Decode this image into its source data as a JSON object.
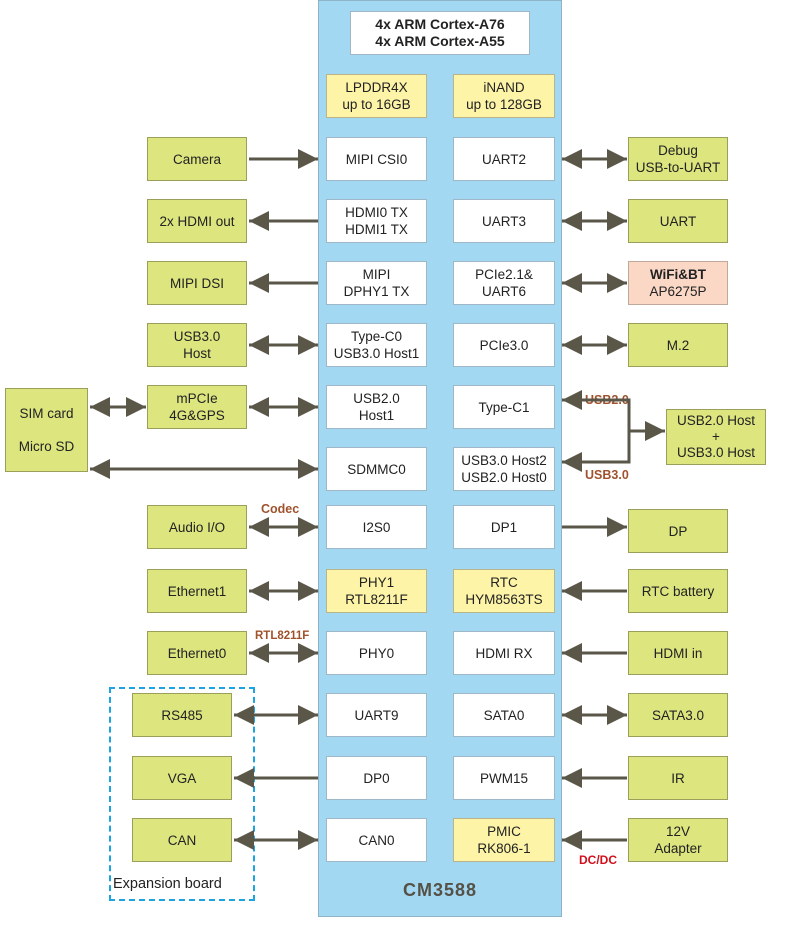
{
  "chip": {
    "name": "CM3588",
    "cpu": [
      "4x ARM Cortex-A76",
      "4x ARM Cortex-A55"
    ],
    "memory": [
      "LPDDR4X",
      "up to 16GB"
    ],
    "storage": [
      "iNAND",
      "up to 128GB"
    ]
  },
  "colors": {
    "panel": "#a3d8f3",
    "external": "#dde57f",
    "onboard": "#fdf4a8",
    "wireless": "#fbd8c5",
    "arrow": "#5a5648",
    "annotation": "#a0522d",
    "power_annotation": "#d0101c",
    "expansion_border": "#1ca3e0"
  },
  "interfaces_left": [
    {
      "lines": [
        "MIPI CSI0"
      ]
    },
    {
      "lines": [
        "HDMI0 TX",
        "HDMI1 TX"
      ]
    },
    {
      "lines": [
        "MIPI",
        "DPHY1 TX"
      ]
    },
    {
      "lines": [
        "Type-C0",
        "USB3.0 Host1"
      ]
    },
    {
      "lines": [
        "USB2.0",
        "Host1"
      ]
    },
    {
      "lines": [
        "SDMMC0"
      ]
    },
    {
      "lines": [
        "I2S0"
      ]
    },
    {
      "lines": [
        "PHY1",
        "RTL8211F"
      ]
    },
    {
      "lines": [
        "PHY0"
      ]
    },
    {
      "lines": [
        "UART9"
      ]
    },
    {
      "lines": [
        "DP0"
      ]
    },
    {
      "lines": [
        "CAN0"
      ]
    }
  ],
  "interfaces_right": [
    {
      "lines": [
        "UART2"
      ]
    },
    {
      "lines": [
        "UART3"
      ]
    },
    {
      "lines": [
        "PCIe2.1&",
        "UART6"
      ]
    },
    {
      "lines": [
        "PCIe3.0"
      ]
    },
    {
      "lines": [
        "Type-C1"
      ]
    },
    {
      "lines": [
        "USB3.0 Host2",
        "USB2.0 Host0"
      ]
    },
    {
      "lines": [
        "DP1"
      ]
    },
    {
      "lines": [
        "RTC",
        "HYM8563TS"
      ]
    },
    {
      "lines": [
        "HDMI RX"
      ]
    },
    {
      "lines": [
        "SATA0"
      ]
    },
    {
      "lines": [
        "PWM15"
      ]
    },
    {
      "lines": [
        "PMIC",
        "RK806-1"
      ]
    }
  ],
  "peripherals_left": [
    {
      "lines": [
        "Camera"
      ],
      "direction": "in"
    },
    {
      "lines": [
        "2x HDMI out"
      ],
      "direction": "out"
    },
    {
      "lines": [
        "MIPI DSI"
      ],
      "direction": "out"
    },
    {
      "lines": [
        "USB3.0",
        "Host"
      ],
      "direction": "both"
    },
    {
      "lines": [
        "mPCIe",
        "4G&GPS"
      ],
      "direction": "both"
    },
    {
      "lines": [
        "Audio I/O"
      ],
      "direction": "both"
    },
    {
      "lines": [
        "Ethernet1"
      ],
      "direction": "both"
    },
    {
      "lines": [
        "Ethernet0"
      ],
      "direction": "both"
    },
    {
      "lines": [
        "RS485"
      ],
      "direction": "both"
    },
    {
      "lines": [
        "VGA"
      ],
      "direction": "out"
    },
    {
      "lines": [
        "CAN"
      ],
      "direction": "both"
    }
  ],
  "peripherals_far_left": {
    "sim_card": "SIM card",
    "micro_sd": "Micro SD"
  },
  "peripherals_right": [
    {
      "lines": [
        "Debug",
        "USB-to-UART"
      ],
      "direction": "both"
    },
    {
      "lines": [
        "UART"
      ],
      "direction": "both"
    },
    {
      "lines": [
        "WiFi&BT",
        "AP6275P"
      ],
      "direction": "both"
    },
    {
      "lines": [
        "M.2"
      ],
      "direction": "both"
    },
    {
      "lines": [
        "USB2.0 Host",
        "+",
        "USB3.0 Host"
      ],
      "direction": "in"
    },
    {
      "lines": [
        "DP"
      ],
      "direction": "out"
    },
    {
      "lines": [
        "RTC battery"
      ],
      "direction": "in"
    },
    {
      "lines": [
        "HDMI in"
      ],
      "direction": "in"
    },
    {
      "lines": [
        "SATA3.0"
      ],
      "direction": "both"
    },
    {
      "lines": [
        "IR"
      ],
      "direction": "in"
    },
    {
      "lines": [
        "12V",
        "Adapter"
      ],
      "direction": "in"
    }
  ],
  "annotations": {
    "usb2": "USB2.0",
    "usb3": "USB3.0",
    "codec": "Codec",
    "rtl": "RTL8211F",
    "dcdc": "DC/DC"
  },
  "expansion_board": "Expansion board"
}
